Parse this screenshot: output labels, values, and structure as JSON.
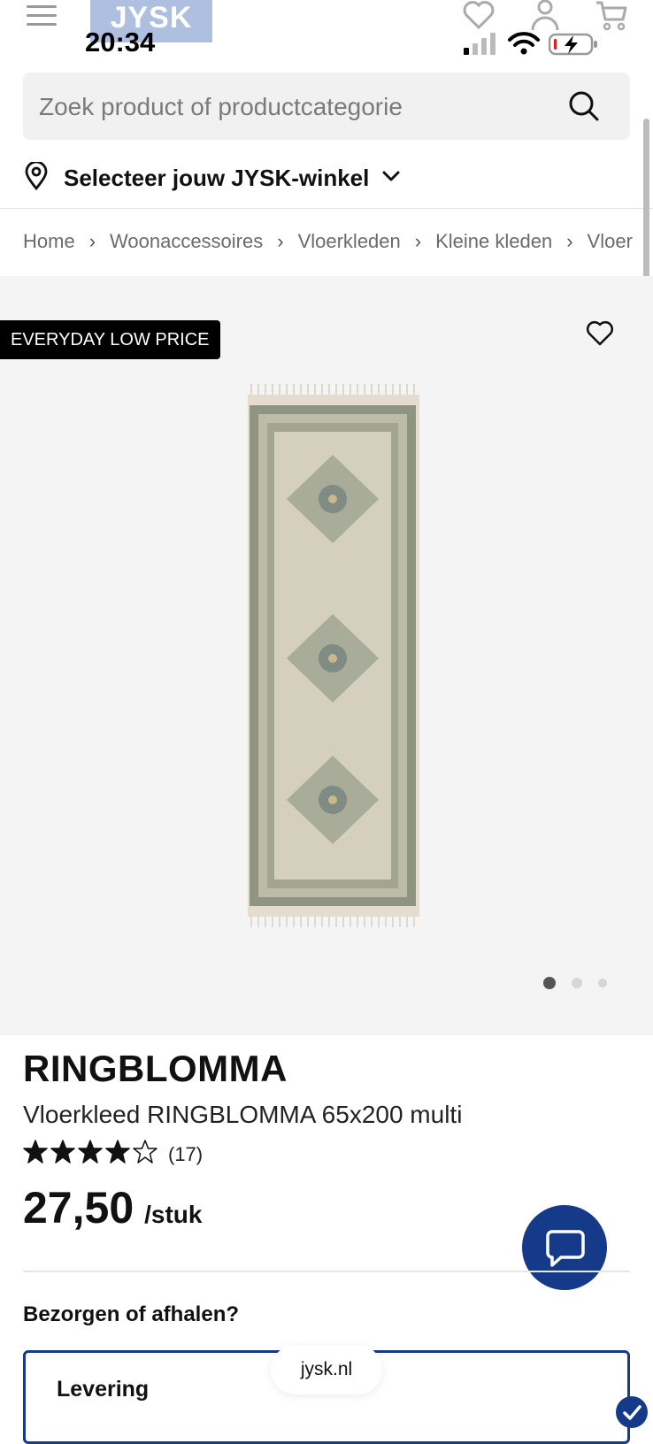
{
  "status_bar": {
    "time": "20:34"
  },
  "header": {
    "logo_text": "JYSK"
  },
  "search": {
    "placeholder": "Zoek product of productcategorie"
  },
  "store": {
    "label": "Selecteer jouw JYSK-winkel"
  },
  "breadcrumb": [
    "Home",
    "Woonaccessoires",
    "Vloerkleden",
    "Kleine kleden",
    "Vloerkleden"
  ],
  "product": {
    "badge": "EVERYDAY LOW PRICE",
    "brand": "RINGBLOMMA",
    "name": "Vloerkleed RINGBLOMMA 65x200 multi",
    "rating": 4,
    "rating_max": 5,
    "review_count": "(17)",
    "price": "27,50",
    "price_unit": "/stuk",
    "image_count": 3,
    "active_image": 1
  },
  "delivery": {
    "question": "Bezorgen of afhalen?",
    "option_label": "Levering"
  },
  "browser": {
    "url": "jysk.nl"
  },
  "colors": {
    "brand_blue": "#163a8a",
    "badge_bg": "#000000",
    "image_bg": "#f4f4f4"
  }
}
